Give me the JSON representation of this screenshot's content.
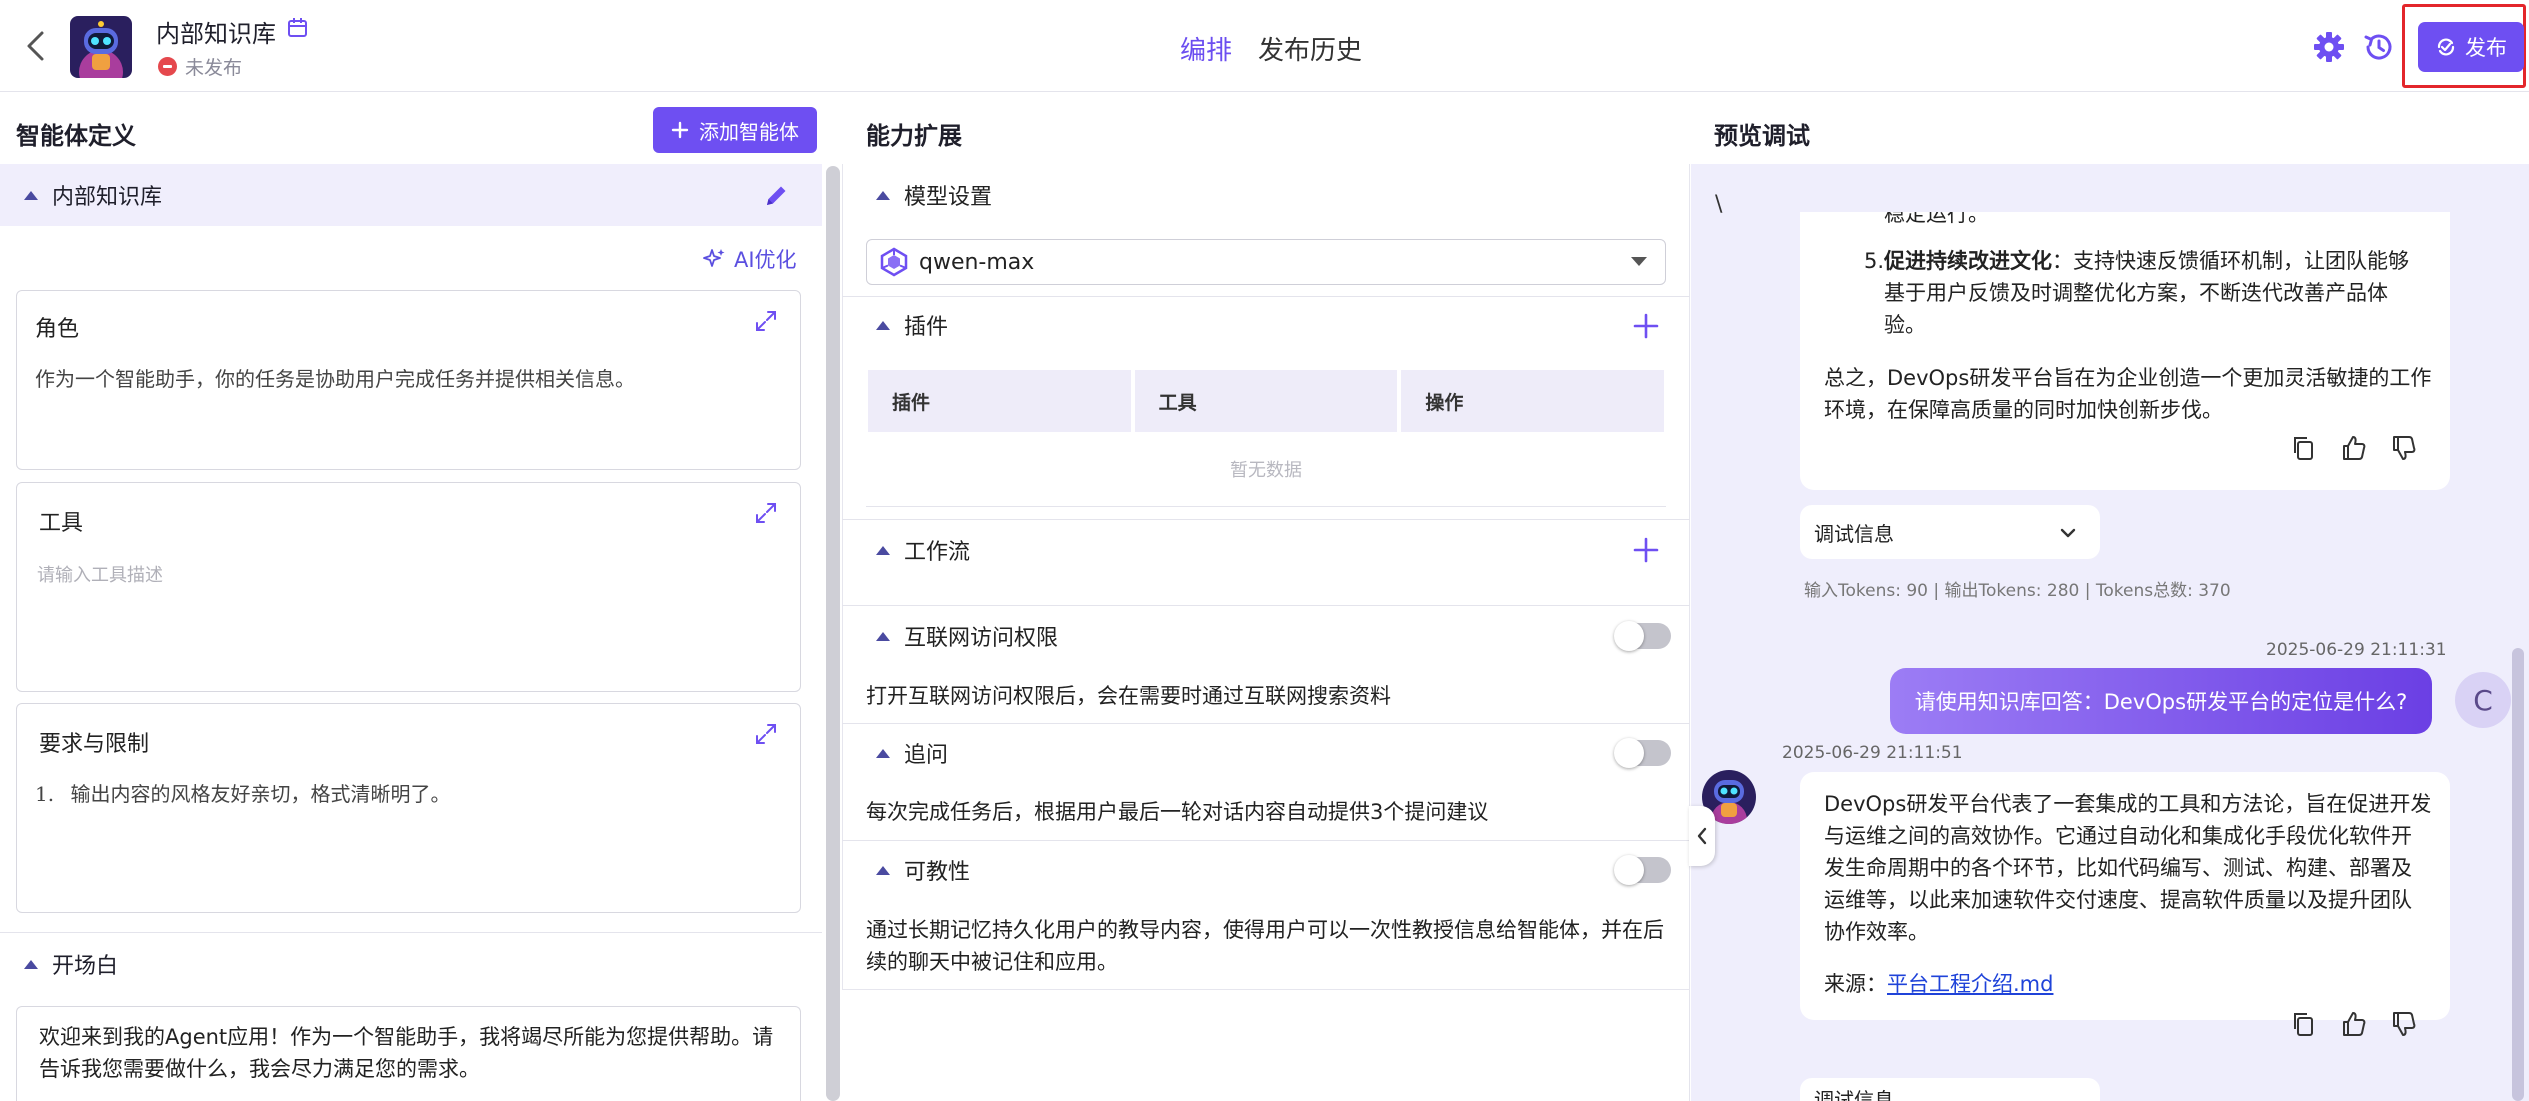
{
  "header": {
    "title": "内部知识库",
    "status": "未发布",
    "tabs": [
      {
        "label": "编排",
        "active": true
      },
      {
        "label": "发布历史",
        "active": false
      }
    ],
    "publish_label": "发布",
    "accent_color": "#6e4ff2"
  },
  "left": {
    "title": "智能体定义",
    "add_button": "添加智能体",
    "section_kb": "内部知识库",
    "ai_optimize": "AI优化",
    "role": {
      "title": "角色",
      "text": "作为一个智能助手，你的任务是协助用户完成任务并提供相关信息。"
    },
    "tools": {
      "title": "工具",
      "placeholder": "请输入工具描述"
    },
    "requirements": {
      "title": "要求与限制",
      "item_num": "1.",
      "item_text": "输出内容的风格友好亲切，格式清晰明了。"
    },
    "opening": {
      "title": "开场白",
      "text": "欢迎来到我的Agent应用！作为一个智能助手，我将竭尽所能为您提供帮助。请告诉我您需要做什么，我会尽力满足您的需求。"
    }
  },
  "middle": {
    "title": "能力扩展",
    "model": {
      "title": "模型设置",
      "value": "qwen-max"
    },
    "plugins": {
      "title": "插件",
      "columns": [
        "插件",
        "工具",
        "操作"
      ],
      "empty": "暂无数据"
    },
    "workflow": {
      "title": "工作流"
    },
    "internet": {
      "title": "互联网访问权限",
      "desc": "打开互联网访问权限后，会在需要时通过互联网搜索资料",
      "enabled": false
    },
    "followup": {
      "title": "追问",
      "desc": "每次完成任务后，根据用户最后一轮对话内容自动提供3个提问建议",
      "enabled": false
    },
    "teachable": {
      "title": "可教性",
      "desc_line1": "通过长期记忆持久化用户的教导内容，使得用户可以一次性教授信息给智能体，并在后",
      "desc_line2": "续的聊天中被记住和应用。",
      "enabled": false
    }
  },
  "right": {
    "title": "预览调试",
    "stray_char": "\\",
    "msg1": {
      "cut_line": "稳定运行。",
      "item_num": "5.",
      "item_bold": "促进持续改进文化",
      "item_line1": "：支持快速反馈循环机制，让团队能够",
      "item_line2": "基于用户反馈及时调整优化方案，不断迭代改善产品体",
      "item_line3": "验。",
      "summary_line1": "总之，DevOps研发平台旨在为企业创造一个更加灵活敏捷的工作",
      "summary_line2": "环境，在保障高质量的同时加快创新步伐。"
    },
    "debug_label": "调试信息",
    "tokens": "输入Tokens: 90 |   输出Tokens: 280 |   Tokens总数: 370",
    "user_time": "2025-06-29 21:11:31",
    "user_msg": "请使用知识库回答：DevOps研发平台的定位是什么?",
    "user_initial": "C",
    "bot_time": "2025-06-29 21:11:51",
    "msg2": {
      "line1": "DevOps研发平台代表了一套集成的工具和方法论，旨在促进开发",
      "line2": "与运维之间的高效协作。它通过自动化和集成化手段优化软件开",
      "line3": "发生命周期中的各个环节，比如代码编写、测试、构建、部署及",
      "line4": "运维等，以此来加速软件交付速度、提高软件质量以及提升团队",
      "line5": "协作效率。",
      "source_label": "来源：",
      "source_link": "平台工程介绍.md"
    },
    "debug_label2": "调试信息"
  }
}
